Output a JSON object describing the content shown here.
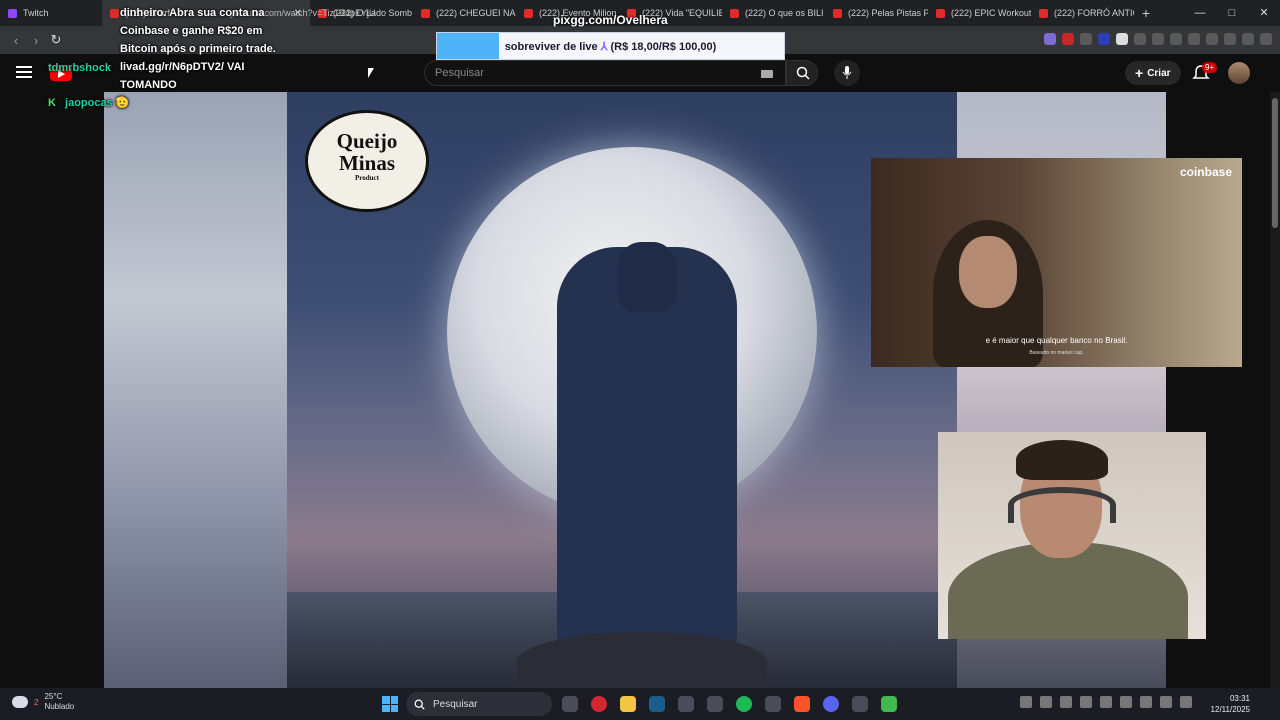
{
  "browser": {
    "tabs": [
      {
        "label": "Twitch",
        "kind": "twitch"
      },
      {
        "label": "(222) Shurf",
        "kind": "youtube",
        "active": true
      },
      {
        "label": "(222) O Lado Somb",
        "kind": "youtube"
      },
      {
        "label": "(222) CHEGUEI NA",
        "kind": "youtube"
      },
      {
        "label": "(222) Evento Milion",
        "kind": "youtube"
      },
      {
        "label": "(222) Vida \"EQUILIB",
        "kind": "youtube"
      },
      {
        "label": "(222) O que os BILI",
        "kind": "youtube"
      },
      {
        "label": "(222) Pelas Pistas P",
        "kind": "youtube"
      },
      {
        "label": "(222) EPIC Workout",
        "kind": "youtube"
      },
      {
        "label": "(222) FORRÓ ANTIG",
        "kind": "youtube"
      }
    ],
    "new_tab": "+",
    "url": "youtube.com/watch?v=Tiz1B4pEYjU",
    "window_controls": {
      "minimize": "—",
      "maximize": "□",
      "close": "✕"
    }
  },
  "youtube": {
    "search_placeholder": "Pesquisar",
    "create_label": "Criar",
    "notifications_badge": "9+"
  },
  "video": {
    "logo_line1": "Queijo",
    "logo_line2": "Minas",
    "logo_line3": "Product"
  },
  "ad": {
    "brand": "coinbase",
    "subtitle": "e é maior que qualquer banco no Brasil.",
    "fineprint": "Baseado no market cap."
  },
  "stream_overlay": {
    "alert_url": "pixgg.com/Ovelhera",
    "alert_text": "sobreviver de live",
    "alert_amount": "(R$ 18,00/R$ 100,00)",
    "alert_progress": 0.18,
    "chat": [
      {
        "user": "tdmrbshock",
        "message": "dinheiro. Abra sua conta na Coinbase e ganhe R$20 em Bitcoin após o primeiro trade. livad.gg/r/N6pDTV2/ VAI TOMANDO"
      },
      {
        "user": "jaopocas",
        "message": ""
      }
    ]
  },
  "taskbar": {
    "weather_temp": "25°C",
    "weather_desc": "Nublado",
    "weather_badge": "2",
    "search_label": "Pesquisar",
    "time": "03:31",
    "date": "12/11/2025"
  }
}
